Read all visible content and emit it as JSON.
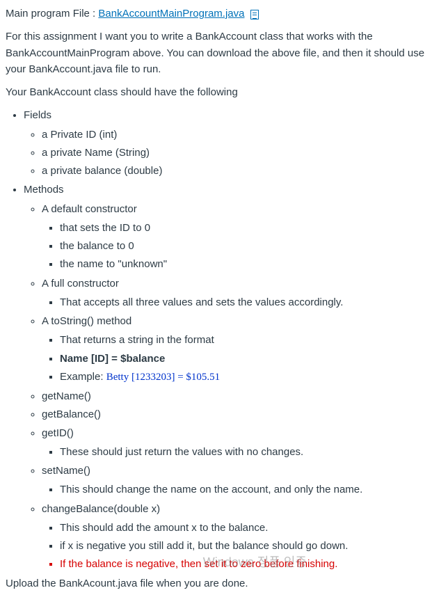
{
  "header": {
    "prefix": "Main program File : ",
    "link_text": "BankAccountMainProgram.java"
  },
  "intro1": "For this assignment I want you to write a BankAccount class that works with the BankAccountMainProgram above.   You can download the above file, and then it should use your BankAccount.java file to run.",
  "intro2": "Your BankAccount class should have the following",
  "list": {
    "fields": "Fields",
    "fields_items": [
      "a Private ID  (int)",
      "a private Name (String)",
      "a private balance (double)"
    ],
    "methods": "Methods",
    "default_ctor": "A default constructor",
    "default_ctor_items": [
      "that sets the ID to 0",
      "the balance to 0",
      "the name to \"unknown\""
    ],
    "full_ctor": "A full constructor",
    "full_ctor_items": [
      "That accepts all three values and sets the values accordingly."
    ],
    "tostring": "A toString() method",
    "tostring_ret": "That returns a string in the format",
    "tostring_fmt": "Name [ID] = $balance",
    "tostring_ex_prefix": "Example: ",
    "tostring_ex_value": "Betty [1233203] = $105.51",
    "getname": "getName()",
    "getbalance": "getBalance()",
    "getid": "getID()",
    "getid_note": "These should just return the values with no changes.",
    "setname": "setName()",
    "setname_note": "This should change the name on the account, and only the name.",
    "changebal": "changeBalance(double x)",
    "changebal_items": [
      "This should add the amount x to the balance.",
      "if x is negative you still add it, but the balance should go down."
    ],
    "changebal_red": "If the balance is negative, then set it to zero before finishing."
  },
  "footer": "Upload the BankAcount.java file when you are done.",
  "watermark": "Windows 정품 인증"
}
